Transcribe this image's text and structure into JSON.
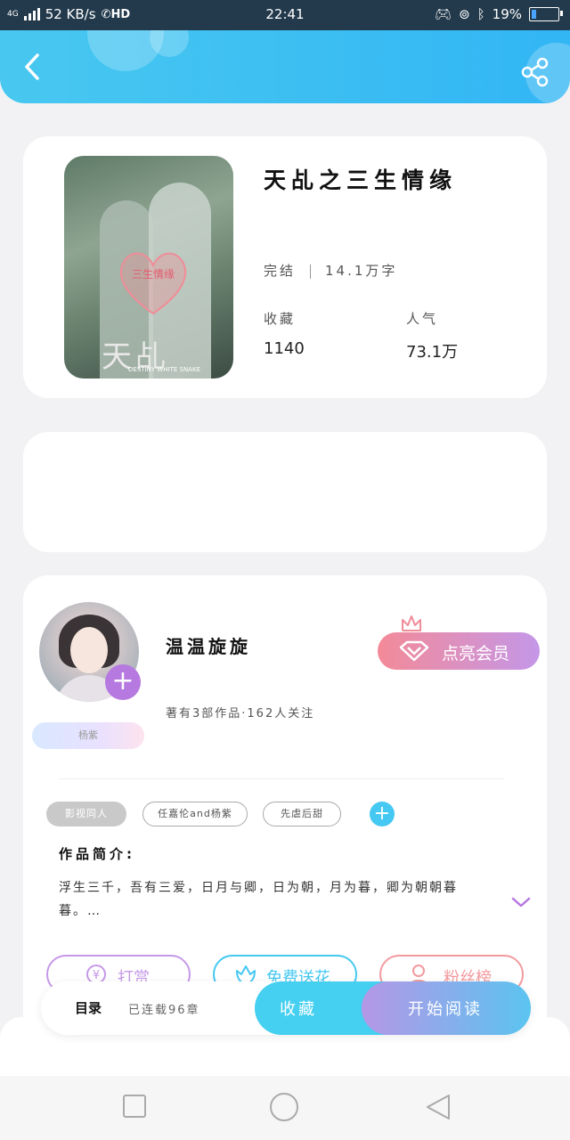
{
  "status_bar": {
    "network": "4G",
    "speed": "52 KB/s",
    "hd": "HD",
    "time": "22:41",
    "battery": "19%",
    "battery_level": 0.19
  },
  "header": {
    "back_icon": "chevron-left-icon",
    "share_icon": "share-icon"
  },
  "book": {
    "title": "天乩之三生情缘",
    "cover_heart_text": "三生情缘",
    "cover_title": "天乩",
    "cover_subtitle": "DESTINY WHITE SNAKE",
    "status": "完结",
    "word_count": "14.1万字",
    "collect_label": "收藏",
    "collect_value": "1140",
    "popularity_label": "人气",
    "popularity_value": "73.1万"
  },
  "author": {
    "name": "温温旋旋",
    "meta": "著有3部作品·162人关注",
    "badge": "杨紫",
    "vip_label": "点亮会员",
    "tags": [
      "影视同人",
      "任嘉伦and杨紫",
      "先虐后甜"
    ],
    "intro_title": "作品简介:",
    "intro_text": "浮生三千，吾有三爱，日月与卿，日为朝，月为暮，卿为朝朝暮暮。…",
    "actions": [
      {
        "label": "打赏",
        "icon": "yen-coin-icon",
        "color": "#c698e8"
      },
      {
        "label": "免费送花",
        "icon": "flower-icon",
        "color": "#45c8f2"
      },
      {
        "label": "粉丝榜",
        "icon": "person-icon",
        "color": "#f29a9e"
      }
    ]
  },
  "bottom_bar": {
    "toc_label": "目录",
    "toc_info": "已连载96章",
    "fav_label": "收藏",
    "start_label": "开始阅读"
  },
  "colors": {
    "header_start": "#48c8f0",
    "header_end": "#32b6f4",
    "accent_purple": "#b679e0",
    "vip_start": "#f38a98",
    "vip_end": "#c497e8"
  }
}
